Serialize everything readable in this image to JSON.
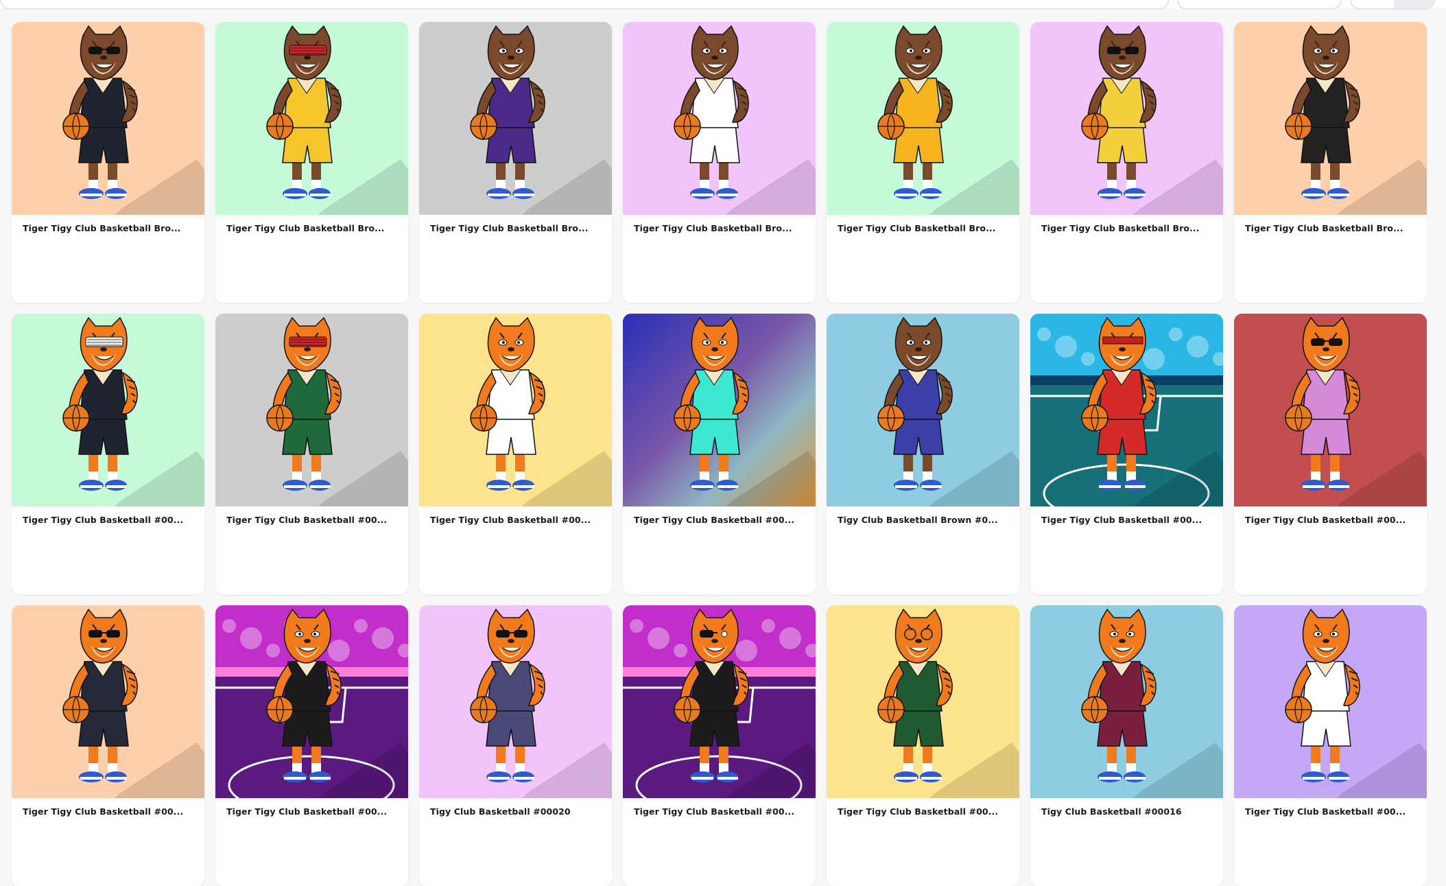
{
  "toolbar": {
    "search_placeholder": "",
    "sort_label": ""
  },
  "colors": {
    "peach": "#fdd0ab",
    "mint": "#c4fad8",
    "grey": "#cdcdcd",
    "pink": "#f1c4fb",
    "yellow": "#fde38b",
    "sky": "#8ecde1",
    "red": "#c24e4f",
    "lavender": "#c5a7f7",
    "tiger_orange": "#f07a1c",
    "tiger_brown": "#7b4a2d"
  },
  "items": [
    {
      "title": "Tiger Tigy Club Basketball Bro...",
      "bg": "peach",
      "fur": "brown",
      "jersey": "#1f2530",
      "glasses": "shades"
    },
    {
      "title": "Tiger Tigy Club Basketball Bro...",
      "bg": "mint",
      "fur": "brown",
      "jersey": "#f4c62b",
      "glasses": "shutter-red"
    },
    {
      "title": "Tiger Tigy Club Basketball Bro...",
      "bg": "grey",
      "fur": "brown",
      "jersey": "#4b2a8a",
      "glasses": "none"
    },
    {
      "title": "Tiger Tigy Club Basketball Bro...",
      "bg": "pink",
      "fur": "brown",
      "jersey": "#ffffff",
      "glasses": "none"
    },
    {
      "title": "Tiger Tigy Club Basketball Bro...",
      "bg": "mint",
      "fur": "brown",
      "jersey": "#f6b51e",
      "glasses": "none"
    },
    {
      "title": "Tiger Tigy Club Basketball Bro...",
      "bg": "pink",
      "fur": "brown",
      "jersey": "#f3cf3b",
      "glasses": "shades"
    },
    {
      "title": "Tiger Tigy Club Basketball Bro...",
      "bg": "peach",
      "fur": "brown",
      "jersey": "#222222",
      "glasses": "none"
    },
    {
      "title": "Tiger Tigy Club Basketball #00...",
      "bg": "mint",
      "fur": "orange",
      "jersey": "#1f2530",
      "glasses": "shutter-white"
    },
    {
      "title": "Tiger Tigy Club Basketball #00...",
      "bg": "grey",
      "fur": "orange",
      "jersey": "#1f6a3a",
      "glasses": "shutter-red"
    },
    {
      "title": "Tiger Tigy Club Basketball #00...",
      "bg": "yellow",
      "fur": "orange",
      "jersey": "#ffffff",
      "glasses": "none"
    },
    {
      "title": "Tiger Tigy Club Basketball #00...",
      "bg": "gradient",
      "fur": "orange",
      "jersey": "#3de8d0",
      "glasses": "none"
    },
    {
      "title": "Tigy Club Basketball Brown #0...",
      "bg": "sky",
      "fur": "brown",
      "jersey": "#3c3fa8",
      "glasses": "none"
    },
    {
      "title": "Tiger Tigy Club Basketball #00...",
      "bg": "court-teal",
      "fur": "orange",
      "jersey": "#d42a2a",
      "glasses": "band"
    },
    {
      "title": "Tiger Tigy Club Basketball #00...",
      "bg": "red",
      "fur": "orange",
      "jersey": "#d48ad8",
      "glasses": "shades"
    },
    {
      "title": "Tiger Tigy Club Basketball #00...",
      "bg": "peach",
      "fur": "orange",
      "jersey": "#252a38",
      "glasses": "shades"
    },
    {
      "title": "Tiger Tigy Club Basketball #00...",
      "bg": "court-purple",
      "fur": "orange",
      "jersey": "#1c1c1c",
      "glasses": "none"
    },
    {
      "title": "Tigy Club Basketball #00020",
      "bg": "pink",
      "fur": "orange",
      "jersey": "#4a4a78",
      "glasses": "shades"
    },
    {
      "title": "Tiger Tigy Club Basketball #00...",
      "bg": "court-purple",
      "fur": "orange",
      "jersey": "#1c1c1c",
      "glasses": "eyepatch"
    },
    {
      "title": "Tiger Tigy Club Basketball #00...",
      "bg": "yellow",
      "fur": "orange",
      "jersey": "#1f5a30",
      "glasses": "clear"
    },
    {
      "title": "Tigy Club Basketball #00016",
      "bg": "sky",
      "fur": "orange",
      "jersey": "#7a1f3d",
      "glasses": "none"
    },
    {
      "title": "Tiger Tigy Club Basketball #00...",
      "bg": "lavender",
      "fur": "orange",
      "jersey": "#ffffff",
      "glasses": "none"
    }
  ]
}
